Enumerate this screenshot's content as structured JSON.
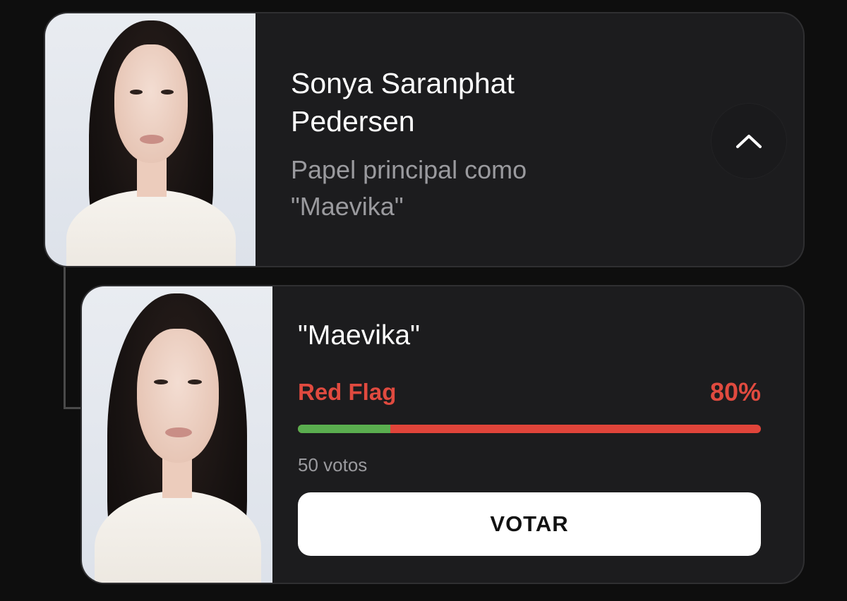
{
  "actor": {
    "name": "Sonya Saranphat Pedersen",
    "role_description": "Papel principal como \"Maevika\"",
    "collapse_icon": "chevron-up-icon"
  },
  "character": {
    "name": "\"Maevika\"",
    "verdict_label": "Red Flag",
    "verdict_percent": "80%",
    "green_flag_fraction": 0.2,
    "red_flag_fraction": 0.8,
    "votes": "50 votos",
    "vote_button_label": "VOTAR"
  },
  "colors": {
    "background": "#0e0e0e",
    "card": "#1c1c1e",
    "red_flag": "#e0443a",
    "green_flag": "#5aae4f"
  }
}
